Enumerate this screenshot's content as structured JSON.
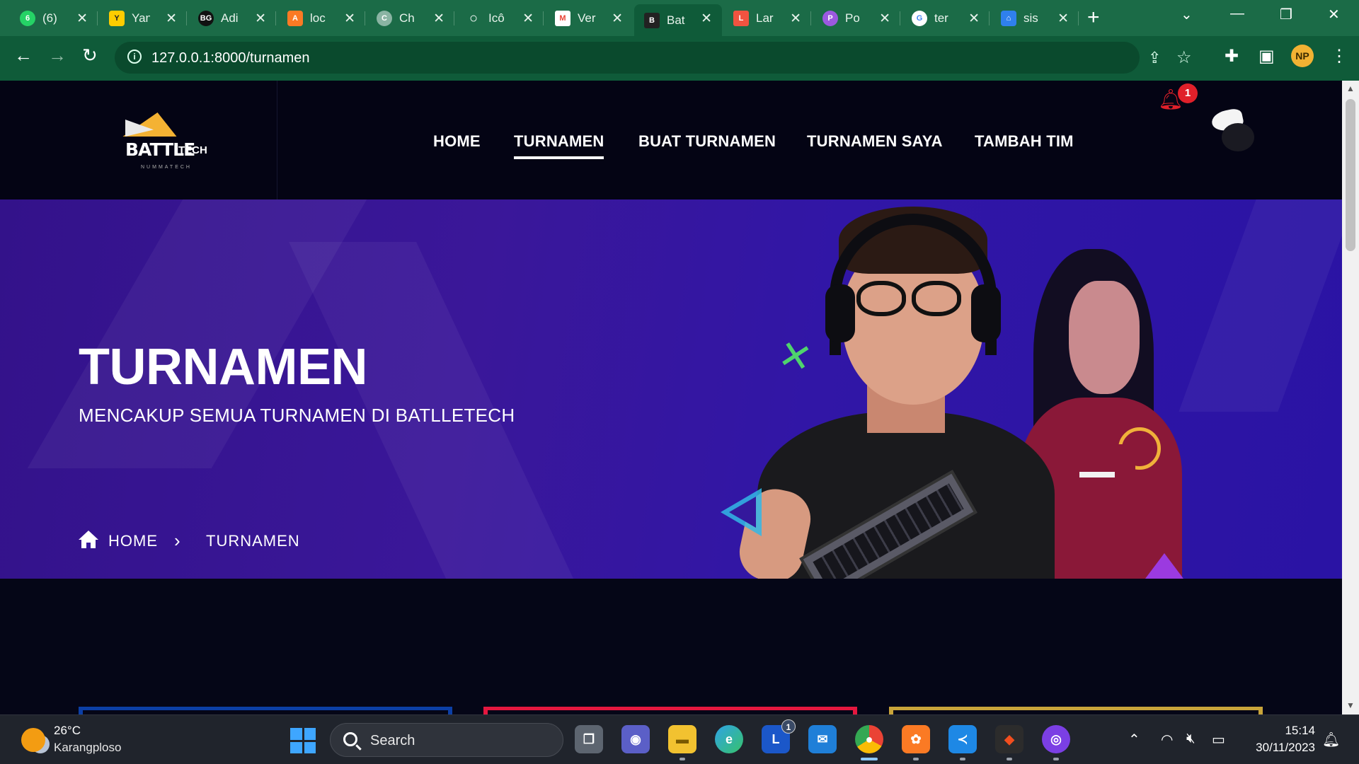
{
  "browser": {
    "tabs": [
      {
        "title": "(6)",
        "icon": "whatsapp-icon",
        "color": "#25d366",
        "glyph": "6"
      },
      {
        "title": "Yan",
        "icon": "yandex-icon",
        "color": "#ffcc00",
        "glyph": "Y"
      },
      {
        "title": "Adi",
        "icon": "bg-icon",
        "color": "#111111",
        "glyph": "BG"
      },
      {
        "title": "loc",
        "icon": "xampp-icon",
        "color": "#fb7a24",
        "glyph": "A"
      },
      {
        "title": "Ch",
        "icon": "chatgpt-icon",
        "color": "#8ab4a3",
        "glyph": "C"
      },
      {
        "title": "Icô",
        "icon": "drop-icon",
        "color": "#1b6b47",
        "glyph": "○"
      },
      {
        "title": "Ver",
        "icon": "gmail-icon",
        "color": "#ea4335",
        "glyph": "M"
      },
      {
        "title": "Bat",
        "icon": "battletech-icon",
        "color": "#222222",
        "glyph": "B"
      },
      {
        "title": "Lar",
        "icon": "laravel-icon",
        "color": "#f05340",
        "glyph": "L"
      },
      {
        "title": "Po",
        "icon": "poe-icon",
        "color": "#9b59e0",
        "glyph": "P"
      },
      {
        "title": "ter",
        "icon": "google-icon",
        "color": "#4285f4",
        "glyph": "G"
      },
      {
        "title": "sis",
        "icon": "home-icon",
        "color": "#2f80ed",
        "glyph": "⌂"
      }
    ],
    "active_tab": 7,
    "url": "127.0.0.1:8000/turnamen",
    "profile_initials": "NP"
  },
  "site": {
    "logo": {
      "word1": "BATTLE",
      "word2": "TECH",
      "word3": "NUMMATECH"
    },
    "nav": {
      "home": "HOME",
      "turnamen": "TURNAMEN",
      "buat": "BUAT TURNAMEN",
      "saya": "TURNAMEN SAYA",
      "tambah": "TAMBAH TIM"
    },
    "notification_count": "1",
    "hero": {
      "title": "TURNAMEN",
      "subtitle": "MENCAKUP SEMUA TURNAMEN DI BATLLETECH",
      "breadcrumb_home": "HOME",
      "breadcrumb_current": "TURNAMEN"
    },
    "card_colors": [
      "#0c3fa6",
      "#e5173f",
      "#c9a43a"
    ]
  },
  "taskbar": {
    "temperature": "26°C",
    "location": "Karangploso",
    "search_label": "Search",
    "mail_badge": "1",
    "time": "15:14",
    "date": "30/11/2023"
  }
}
